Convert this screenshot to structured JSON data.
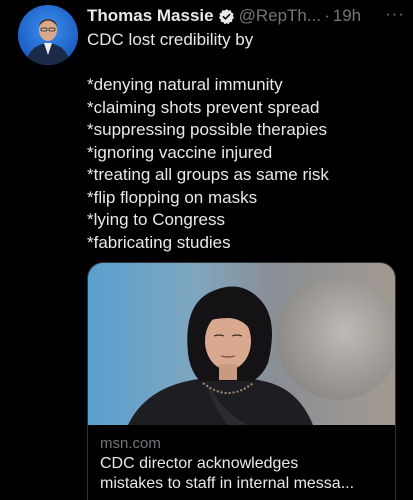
{
  "author": {
    "display_name": "Thomas Massie",
    "handle": "@RepTh...",
    "separator": "·",
    "time": "19h",
    "verified": true,
    "more_icon": "···"
  },
  "tweet": {
    "intro": "CDC lost credibility by",
    "items": [
      "*denying natural immunity",
      "*claiming shots prevent spread",
      "*suppressing possible therapies",
      "*ignoring vaccine injured",
      "*treating all groups as same risk",
      "*flip flopping on masks",
      "*lying to Congress",
      "*fabricating studies"
    ]
  },
  "card": {
    "domain": "msn.com",
    "title_line1": "CDC director acknowledges",
    "title_line2": "mistakes to staff in internal messa..."
  },
  "colors": {
    "background": "#000000",
    "text": "#e7e9ea",
    "muted": "#71767b",
    "verified": "#1d9bf0",
    "border": "#2f3336"
  }
}
